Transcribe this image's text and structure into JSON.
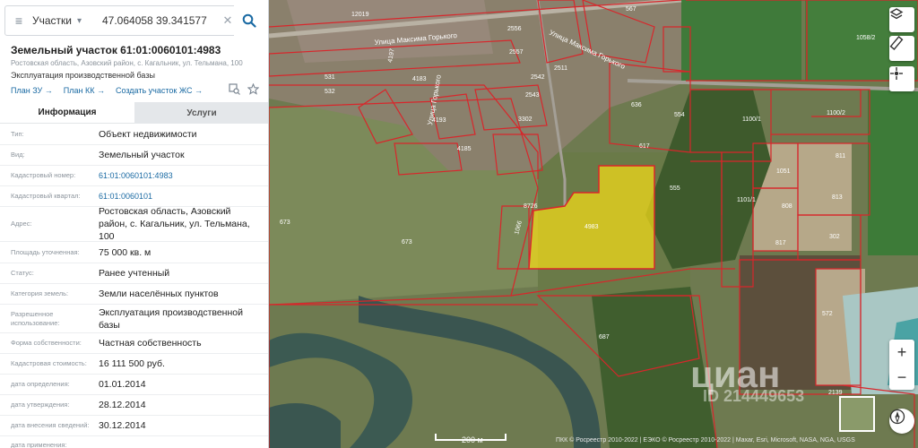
{
  "search": {
    "type_label": "Участки",
    "value": "47.064058 39.341577"
  },
  "object": {
    "title": "Земельный участок 61:01:0060101:4983",
    "address_small": "Ростовская область, Азовский район, с. Кагальник, ул. Тельмана, 100",
    "use": "Эксплуатация производственной базы"
  },
  "links": [
    {
      "label": "План ЗУ"
    },
    {
      "label": "План КК"
    },
    {
      "label": "Создать участок ЖС"
    }
  ],
  "tabs": [
    {
      "label": "Информация"
    },
    {
      "label": "Услуги"
    }
  ],
  "rows": [
    {
      "key": "Тип:",
      "value": "Объект недвижимости"
    },
    {
      "key": "Вид:",
      "value": "Земельный участок"
    },
    {
      "key": "Кадастровый номер:",
      "value": "61:01:0060101:4983"
    },
    {
      "key": "Кадастровый квартал:",
      "value": "61:01:0060101"
    },
    {
      "key": "Адрес:",
      "value": "Ростовская область, Азовский район, с. Кагальник, ул. Тельмана, 100"
    },
    {
      "key": "Площадь уточненная:",
      "value": "75 000 кв. м"
    },
    {
      "key": "Статус:",
      "value": "Ранее учтенный"
    },
    {
      "key": "Категория земель:",
      "value": "Земли населённых пунктов"
    },
    {
      "key": "Разрешенное использование:",
      "value": "Эксплуатация производственной базы"
    },
    {
      "key": "Форма собственности:",
      "value": "Частная собственность"
    },
    {
      "key": "Кадастровая стоимость:",
      "value": "16 111 500 руб."
    },
    {
      "key": "дата определения:",
      "value": "01.01.2014"
    },
    {
      "key": "дата утверждения:",
      "value": "28.12.2014"
    },
    {
      "key": "дата внесения сведений:",
      "value": "30.12.2014"
    },
    {
      "key": "дата применения:",
      "value": ""
    }
  ],
  "map": {
    "street_1": "Улица Максима Горького",
    "street_2": "Улица Максима Горького",
    "street_3": "Улица Горького",
    "parcel_labels": [
      "1058/2",
      "1100/1",
      "1100/2",
      "4983",
      "555",
      "554",
      "636",
      "617",
      "1101/1",
      "1051",
      "808",
      "813",
      "811",
      "302",
      "817",
      "572",
      "2139",
      "687",
      "673",
      "673",
      "8726",
      "1066",
      "4185",
      "4193",
      "3302",
      "2543",
      "2542",
      "2511",
      "2556",
      "2557",
      "531",
      "532",
      "4197",
      "4183",
      "12019",
      "567"
    ],
    "scale_label": "200 м",
    "attribution": "ПКК © Росреестр 2010-2022 | ЕЭКО © Росреестр 2010-2022 | Maxar, Esri, Microsoft, NASA, NGA, USGS",
    "watermark": "циан",
    "watermark_id": "ID 214449653",
    "colors": {
      "parcel_outline": "#d8262b",
      "selected_fill": "#f5dd18"
    }
  },
  "icons": {
    "menu": "menu-icon",
    "search": "search-icon",
    "clear": "close-icon",
    "layers": "layers-icon",
    "ruler": "ruler-icon",
    "locate": "locate-icon",
    "zoom_in": "plus-icon",
    "zoom_out": "minus-icon",
    "compass": "compass-icon"
  }
}
